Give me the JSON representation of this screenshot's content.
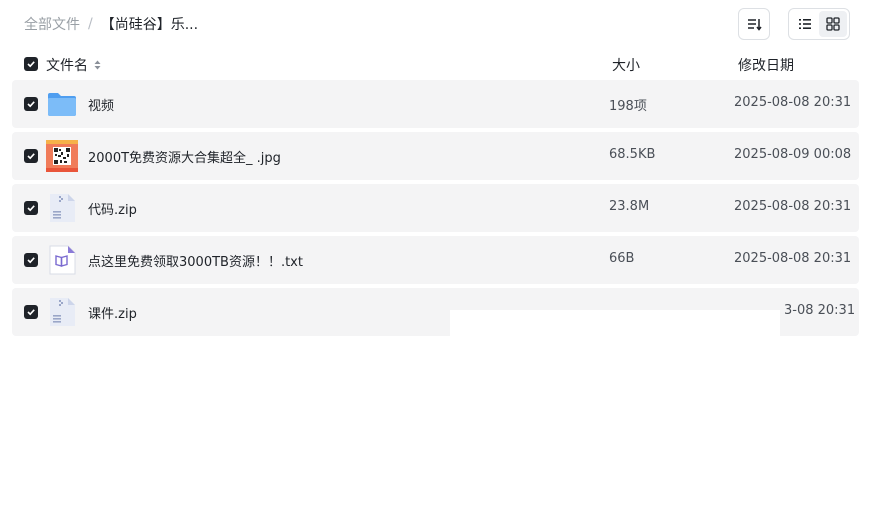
{
  "breadcrumb": {
    "root": "全部文件",
    "separator": "/",
    "current": "【尚硅谷】乐..."
  },
  "toolbar": {
    "sort_icon": "sort-icon",
    "views": [
      {
        "icon": "list-view-icon",
        "active": false
      },
      {
        "icon": "grid-view-icon",
        "active": true
      }
    ]
  },
  "columns": {
    "name": "文件名",
    "size": "大小",
    "date": "修改日期"
  },
  "files": [
    {
      "name": "视频",
      "size": "198项",
      "date": "2025-08-08 20:31",
      "icon": "folder-icon",
      "checked": true
    },
    {
      "name": "2000T免费资源大合集超全_ .jpg",
      "size": "68.5KB",
      "date": "2025-08-09 00:08",
      "icon": "image-thumbnail-icon",
      "checked": true
    },
    {
      "name": "代码.zip",
      "size": "23.8M",
      "date": "2025-08-08 20:31",
      "icon": "zip-file-icon",
      "checked": true
    },
    {
      "name": "点这里免费领取3000TB资源！！.txt",
      "size": "66B",
      "date": "2025-08-08 20:31",
      "icon": "text-file-icon",
      "checked": true
    },
    {
      "name": "课件.zip",
      "size": "",
      "date": "3-08 20:31",
      "icon": "zip-file-icon",
      "checked": true
    }
  ],
  "colors": {
    "row_bg": "#f4f4f5",
    "checkbox": "#1f2329",
    "folder": "#5aa8f5"
  }
}
